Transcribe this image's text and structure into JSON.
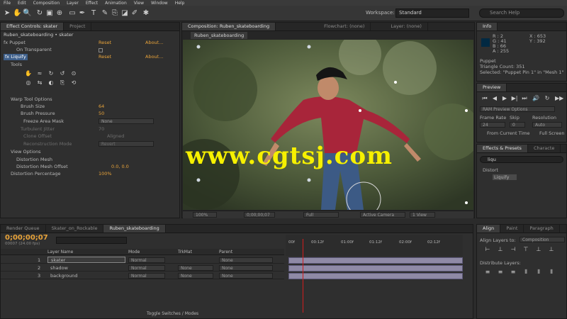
{
  "menu": [
    "File",
    "Edit",
    "Composition",
    "Layer",
    "Effect",
    "Animation",
    "View",
    "Window",
    "Help"
  ],
  "toolbar": {
    "workspace_label": "Workspace:",
    "workspace_value": "Standard",
    "search_placeholder": "Search Help"
  },
  "effect_controls": {
    "tabs": [
      "Effect Controls: skater",
      "Project"
    ],
    "header": "Ruben_skateboarding • skater",
    "rows": [
      {
        "label": "fx Puppet",
        "reset": "Reset",
        "about": "About..."
      },
      {
        "label": "On Transparent"
      },
      {
        "label": "fx Liquify",
        "reset": "Reset",
        "about": "About..."
      },
      {
        "label": "Tools"
      },
      {
        "label": "Warp Tool Options"
      },
      {
        "label": "Brush Size",
        "value": "64"
      },
      {
        "label": "Brush Pressure",
        "value": "50"
      },
      {
        "label": "Freeze Area Mask",
        "value": "None"
      },
      {
        "label": "Turbulent Jitter",
        "value": "70"
      },
      {
        "label": "Clone Offset",
        "value": "Aligned"
      },
      {
        "label": "Reconstruction Mode",
        "value": "Revert"
      },
      {
        "label": "View Options"
      },
      {
        "label": "Distortion Mesh"
      },
      {
        "label": "Distortion Mesh Offset",
        "value": "0.0, 0.0"
      },
      {
        "label": "Distortion Percentage",
        "value": "100%"
      }
    ]
  },
  "composition": {
    "tabs": [
      "Composition: Ruben_skateboarding",
      "Flowchart: (none)",
      "Layer: (none)"
    ],
    "sub_tab": "Ruben_skateboarding",
    "zoom": "100%",
    "timecode": "0;00;00;07",
    "resolution": "Full",
    "camera": "Active Camera",
    "view": "1 View",
    "watermark": "www.cgtsj.com"
  },
  "info": {
    "tab": "Info",
    "r": "R : 2",
    "g": "G : 41",
    "b": "B : 66",
    "a": "A : 255",
    "x": "X : 653",
    "y": "Y : 392",
    "line1": "Puppet",
    "line2": "Triangle Count: 351",
    "line3": "Selected: \"Puppet Pin 1\" in \"Mesh 1\""
  },
  "preview": {
    "tab": "Preview",
    "ram": "RAM Preview Options",
    "frame_rate_label": "Frame Rate",
    "skip_label": "Skip",
    "resolution_label": "Resolution",
    "frame_rate": "24",
    "skip": "0",
    "resolution": "Auto",
    "from_current": "From Current Time",
    "full_screen": "Full Screen"
  },
  "effects_presets": {
    "tabs": [
      "Effects & Presets",
      "Characte"
    ],
    "search": "liqu",
    "group": "Distort",
    "item": "Liquify"
  },
  "align": {
    "tabs": [
      "Align",
      "Paint",
      "Paragraph"
    ],
    "align_to_label": "Align Layers to:",
    "align_to": "Composition",
    "distribute": "Distribute Layers:"
  },
  "timeline": {
    "tabs": [
      "Render Queue",
      "Skater_on_Rockable",
      "Ruben_skateboarding"
    ],
    "timecode": "0;00;00;07",
    "fps": "00007 (24.00 fps)",
    "col_layer": "Layer Name",
    "col_mode": "Mode",
    "col_trkmat": "TrkMat",
    "col_parent": "Parent",
    "layers": [
      {
        "num": "1",
        "name": "skater",
        "mode": "Normal",
        "trkmat": "",
        "parent": "None"
      },
      {
        "num": "2",
        "name": "shadow",
        "mode": "Normal",
        "trkmat": "None",
        "parent": "None"
      },
      {
        "num": "3",
        "name": "background",
        "mode": "Normal",
        "trkmat": "None",
        "parent": "None"
      }
    ],
    "ruler": [
      "00f",
      "00:12f",
      "01:00f",
      "01:12f",
      "02:00f",
      "02:12f"
    ],
    "toggle": "Toggle Switches / Modes"
  }
}
